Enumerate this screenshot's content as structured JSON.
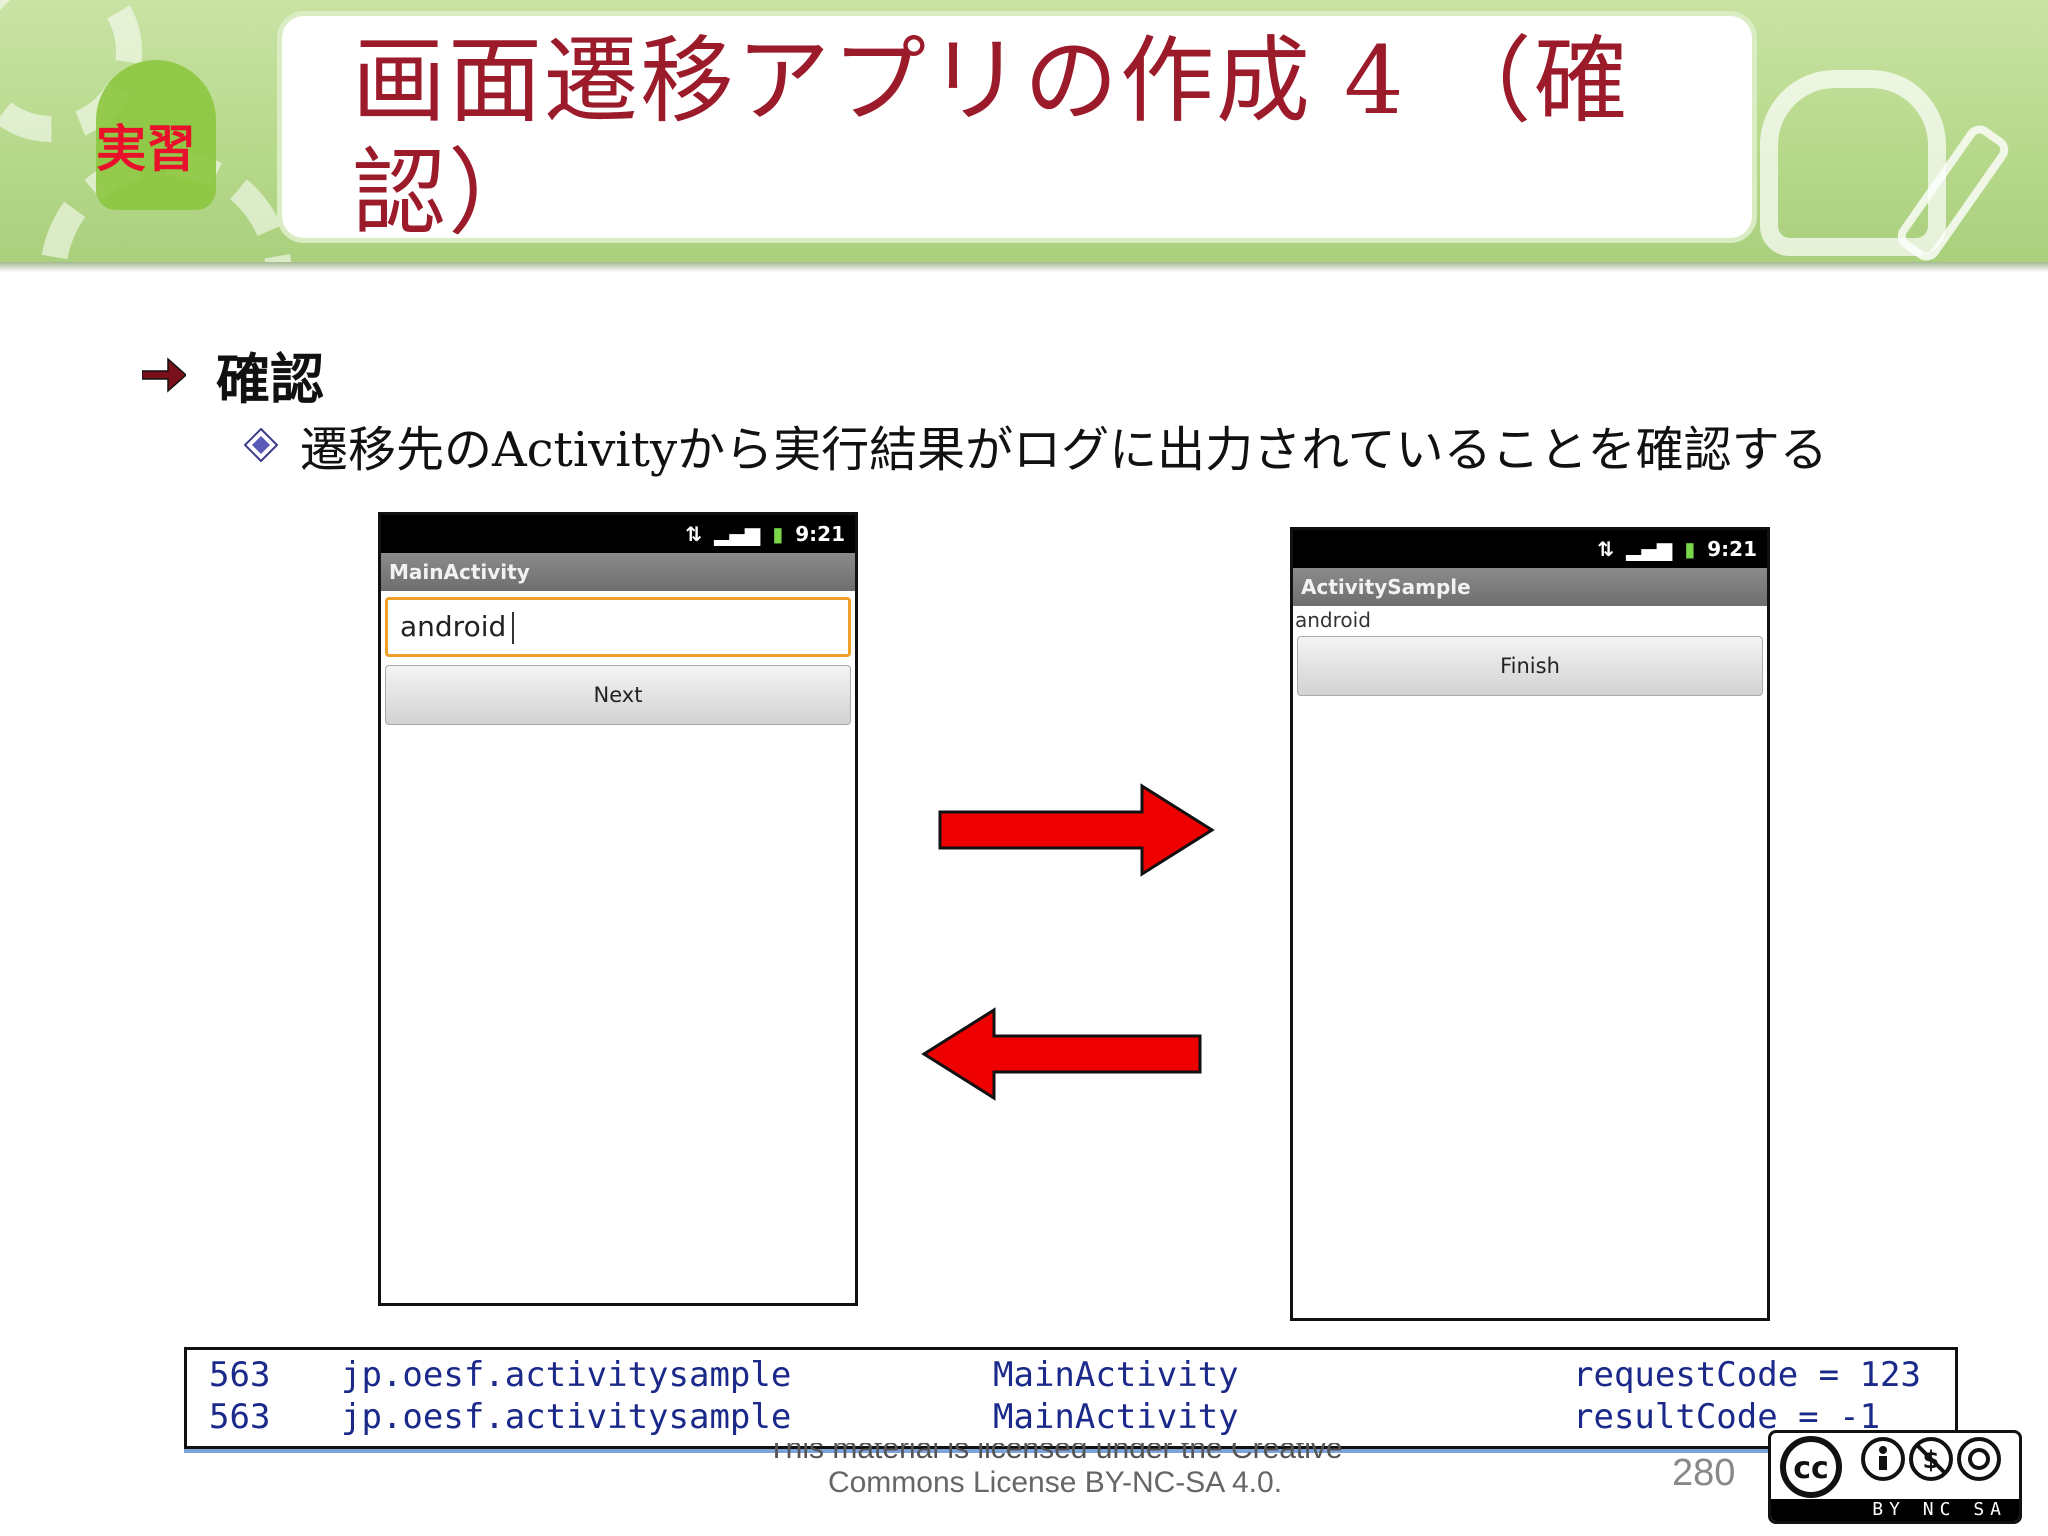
{
  "slide": {
    "title": "画面遷移アプリの作成 4 （確認）",
    "badge": "実習",
    "bullet_heading": "確認",
    "bullet_text": "遷移先のActivityから実行結果がログに出力されていることを確認する",
    "page_number": "280",
    "license_line1": "This material is licensed under the Creative",
    "license_line2": "Commons License BY-NC-SA 4.0.",
    "license_badge": {
      "label": "cc",
      "terms": "BY NC SA"
    }
  },
  "phone_main": {
    "clock": "9:21",
    "app_title": "MainActivity",
    "input_value": "android",
    "button_label": "Next"
  },
  "phone_sample": {
    "clock": "9:21",
    "app_title": "ActivitySample",
    "result_text": "android",
    "button_label": "Finish"
  },
  "log": {
    "rows": [
      {
        "pid": "563",
        "app": "jp.oesf.activitysample",
        "tag": "MainActivity",
        "message": "requestCode = 123"
      },
      {
        "pid": "563",
        "app": "jp.oesf.activitysample",
        "tag": "MainActivity",
        "message": "resultCode = -1"
      }
    ]
  },
  "colors": {
    "title": "#9b1b2b",
    "banner": "#b7d98c",
    "arrow": "#ee0000",
    "log_text": "#1b2a8a"
  }
}
